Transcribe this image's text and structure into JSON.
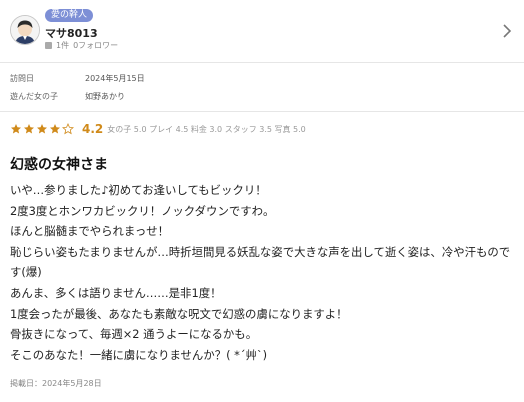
{
  "user": {
    "badge": "愛の幹人",
    "name": "マサ8013",
    "reviews": "1件",
    "followers": "0フォロワー"
  },
  "visit": {
    "date_label": "訪問日",
    "date_value": "2024年5月15日",
    "girl_label": "遊んだ女の子",
    "girl_value": "如野あかり"
  },
  "rating": {
    "score": "4.2",
    "stars": 4,
    "max": 5,
    "subscores_text": "女の子 5.0 プレイ 4.5 料金 3.0 スタッフ 3.5 写真 5.0"
  },
  "review": {
    "title": "幻惑の女神さま",
    "lines": [
      "いや…参りました♪初めてお逢いしてもビックリ！",
      "2度3度とホンワカビックリ！ノックダウンですわ。",
      "ほんと脳髄までやられまっせ！",
      "恥じらい姿もたまりませんが…時折垣間見る妖乱な姿で大きな声を出して逝く姿は、冷や汗ものです(爆)",
      "あんま、多くは語りません……是非1度！",
      "1度会ったが最後、あなたも素敵な呪文で幻惑の虜になりますよ！",
      "骨抜きになって、毎週×2 通うよーになるかも。",
      "そこのあなた！一緒に虜になりませんか？( *´艸`)"
    ],
    "posted": "掲載日：2024年5月28日"
  },
  "colors": {
    "badge": "#7d8fd6",
    "star": "#d08a1a",
    "star_empty": "#d0d0d0"
  }
}
